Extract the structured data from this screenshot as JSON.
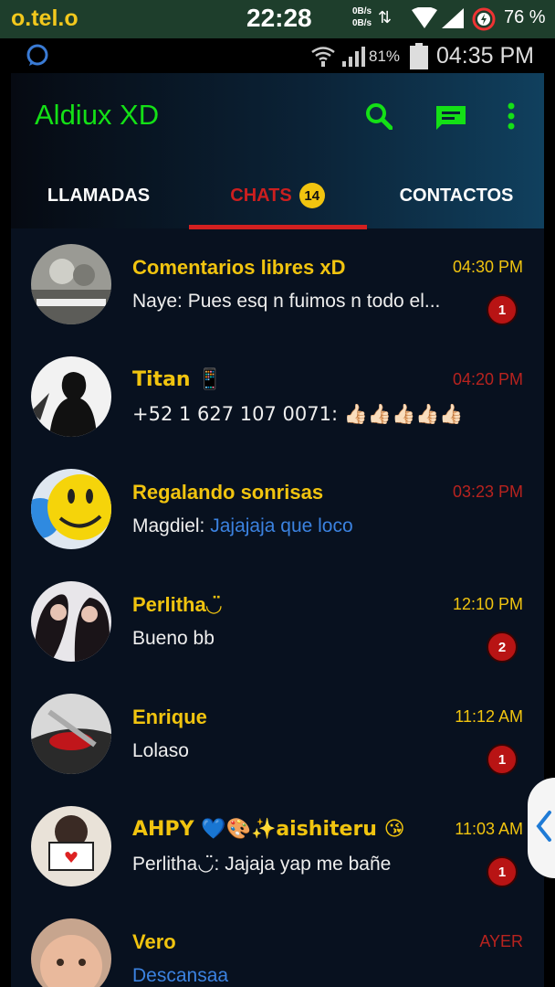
{
  "status_bar": {
    "carrier": "o.tel.o",
    "time": "22:28",
    "net_up": "0B/s",
    "net_down": "0B/s",
    "battery": "76 %"
  },
  "inner_status": {
    "battery": "81%",
    "time": "04:35 PM"
  },
  "app": {
    "title": "Aldiux XD",
    "accent": "#14e016",
    "icons": [
      "search-icon",
      "compose-message-icon",
      "overflow-menu-icon"
    ]
  },
  "tabs": [
    {
      "label": "LLAMADAS",
      "active": false
    },
    {
      "label": "CHATS",
      "active": true,
      "badge": "14"
    },
    {
      "label": "CONTACTOS",
      "active": false
    }
  ],
  "chats": [
    {
      "name": "Comentarios libres xD",
      "time": "04:30 PM",
      "time_color": "yellow",
      "sender": "Naye: ",
      "message": "Pues esq n fuimos n todo el...",
      "unread": "1"
    },
    {
      "name": "Titan 📱",
      "time": "04:20 PM",
      "time_color": "red",
      "sender": "",
      "message": "+52 1 627 107 0071: 👍🏻👍🏻👍🏻👍🏻👍🏻",
      "unread": ""
    },
    {
      "name": "Regalando sonrisas",
      "time": "03:23 PM",
      "time_color": "red",
      "sender": "Magdiel: ",
      "message": "Jajajaja que loco",
      "message_color": "blue",
      "unread": ""
    },
    {
      "name": "Perlitha◡̈",
      "time": "12:10 PM",
      "time_color": "yellow",
      "sender": "",
      "message": "Bueno bb",
      "unread": "2"
    },
    {
      "name": "Enrique",
      "time": "11:12 AM",
      "time_color": "yellow",
      "sender": "",
      "message": "Lolaso",
      "unread": "1"
    },
    {
      "name": "AHPY 💙🎨✨aishiteru 😘",
      "time": "11:03 AM",
      "time_color": "yellow",
      "sender": "Perlitha◡̈: ",
      "message": "Jajaja yap me bañe",
      "unread": "1"
    },
    {
      "name": "Vero",
      "time": "AYER",
      "time_color": "red",
      "sender": "",
      "message": "Descansaa",
      "message_color": "blue",
      "unread": ""
    }
  ]
}
